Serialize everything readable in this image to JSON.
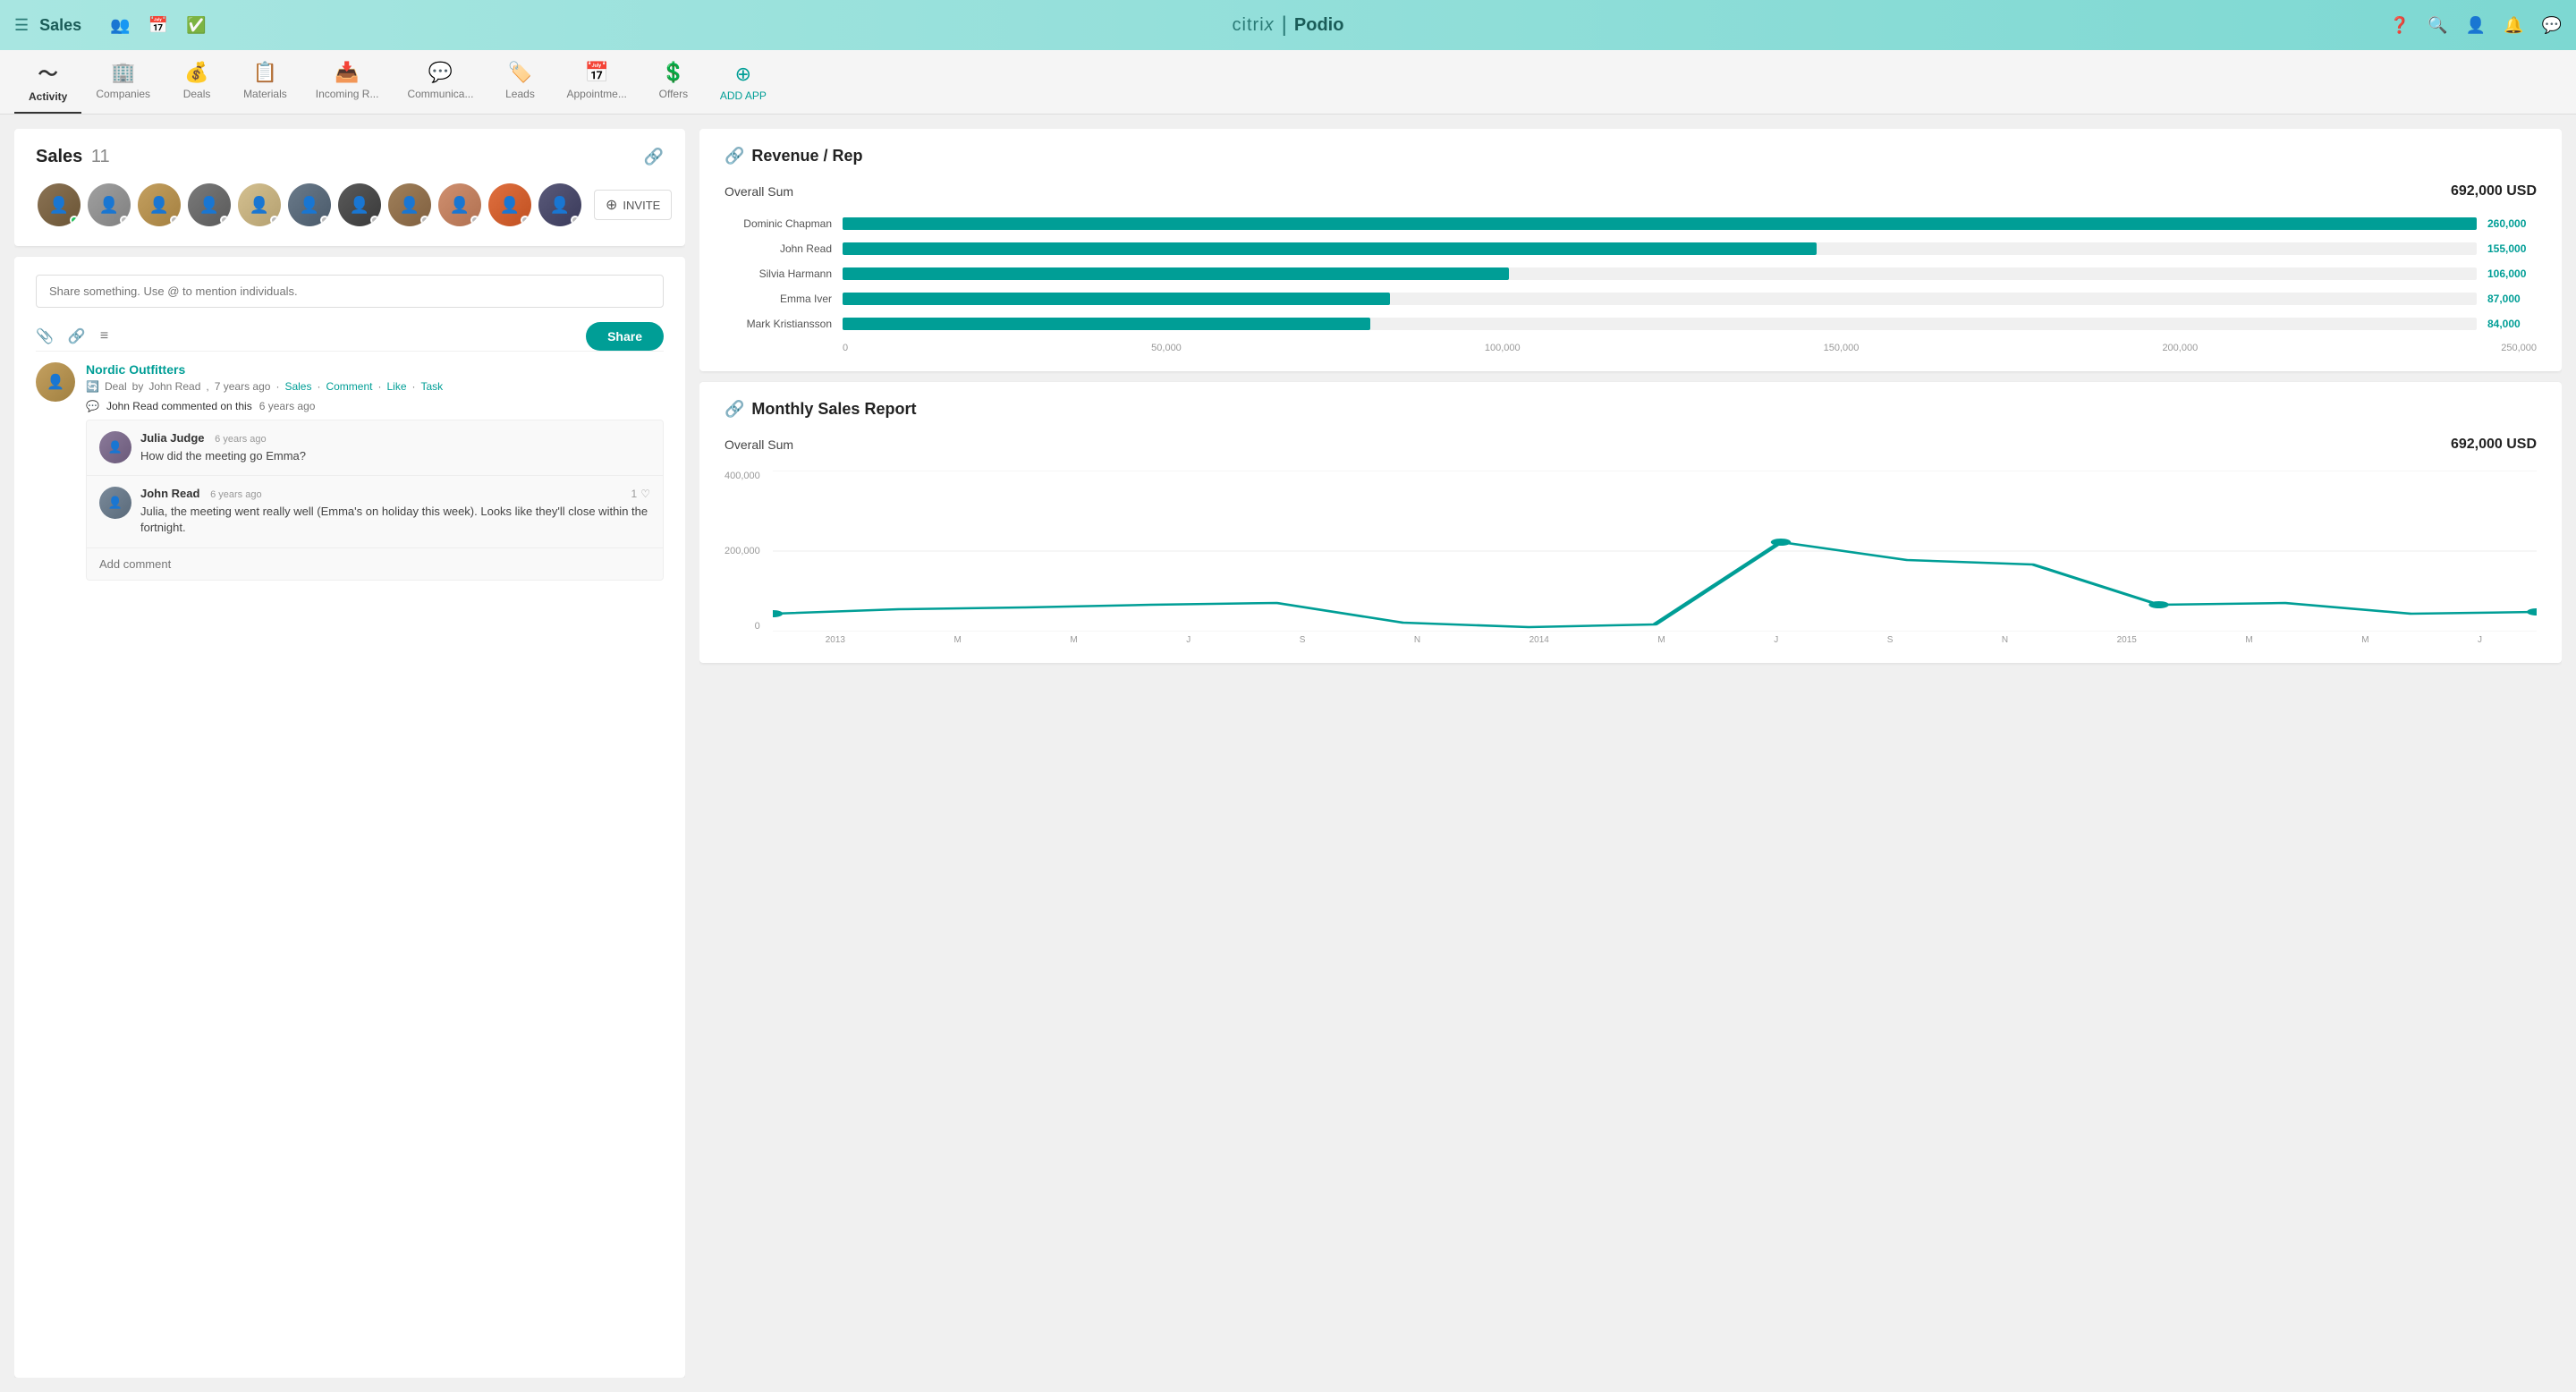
{
  "topNav": {
    "appName": "Sales",
    "logoLeft": "citrix",
    "logoDivider": "|",
    "logoRight": "Podio"
  },
  "tabs": [
    {
      "id": "activity",
      "label": "Activity",
      "icon": "📈",
      "active": true
    },
    {
      "id": "companies",
      "label": "Companies",
      "icon": "🏢",
      "active": false
    },
    {
      "id": "deals",
      "label": "Deals",
      "icon": "💰",
      "active": false
    },
    {
      "id": "materials",
      "label": "Materials",
      "icon": "📋",
      "active": false
    },
    {
      "id": "incoming",
      "label": "Incoming R...",
      "icon": "📥",
      "active": false
    },
    {
      "id": "communica",
      "label": "Communica...",
      "icon": "💬",
      "active": false
    },
    {
      "id": "leads",
      "label": "Leads",
      "icon": "🏷️",
      "active": false
    },
    {
      "id": "appointments",
      "label": "Appointme...",
      "icon": "📅",
      "active": false
    },
    {
      "id": "offers",
      "label": "Offers",
      "icon": "💲",
      "active": false
    },
    {
      "id": "addapp",
      "label": "ADD APP",
      "icon": "⊕",
      "active": false
    }
  ],
  "salesCard": {
    "title": "Sales",
    "count": "11",
    "inviteLabel": "INVITE"
  },
  "shareBox": {
    "placeholder": "Share something. Use @ to mention individuals.",
    "shareButtonLabel": "Share"
  },
  "feedItem": {
    "organizationName": "Nordic Outfitters",
    "metaType": "Deal",
    "metaBy": "by",
    "metaAuthor": "John Read",
    "metaTime": "7 years ago",
    "metaWorkspace": "Sales",
    "metaActions": [
      "Comment",
      "Like",
      "Task"
    ],
    "commentLine": "John Read commented on this",
    "commentLineTime": "6 years ago"
  },
  "comments": [
    {
      "author": "Julia Judge",
      "time": "6 years ago",
      "text": "How did the meeting go Emma?",
      "likes": 0
    },
    {
      "author": "John Read",
      "time": "6 years ago",
      "text": "Julia, the meeting went really well (Emma's on holiday this week). Looks like they'll close within the fortnight.",
      "likes": 1
    }
  ],
  "addCommentPlaceholder": "Add comment",
  "revenueChart": {
    "title": "Revenue / Rep",
    "overallLabel": "Overall Sum",
    "overallValue": "692,000 USD",
    "bars": [
      {
        "name": "Dominic Chapman",
        "value": 260000,
        "valueLabel": "260,000",
        "pct": 100
      },
      {
        "name": "John Read",
        "value": 155000,
        "valueLabel": "155,000",
        "pct": 59.6
      },
      {
        "name": "Silvia Harmann",
        "value": 106000,
        "valueLabel": "106,000",
        "pct": 40.8
      },
      {
        "name": "Emma Iver",
        "value": 87000,
        "valueLabel": "87,000",
        "pct": 33.5
      },
      {
        "name": "Mark Kristiansson",
        "value": 84000,
        "valueLabel": "84,000",
        "pct": 32.3
      }
    ],
    "xAxis": [
      "0",
      "50,000",
      "100,000",
      "150,000",
      "200,000",
      "250,000"
    ]
  },
  "monthlyChart": {
    "title": "Monthly Sales Report",
    "overallLabel": "Overall Sum",
    "overallValue": "692,000 USD",
    "yLabels": [
      "400,000",
      "200,000",
      "0"
    ],
    "xLabels": [
      "2013",
      "M",
      "M",
      "J",
      "S",
      "N",
      "2014",
      "M",
      "J",
      "S",
      "N",
      "2015",
      "M",
      "M",
      "J"
    ]
  }
}
